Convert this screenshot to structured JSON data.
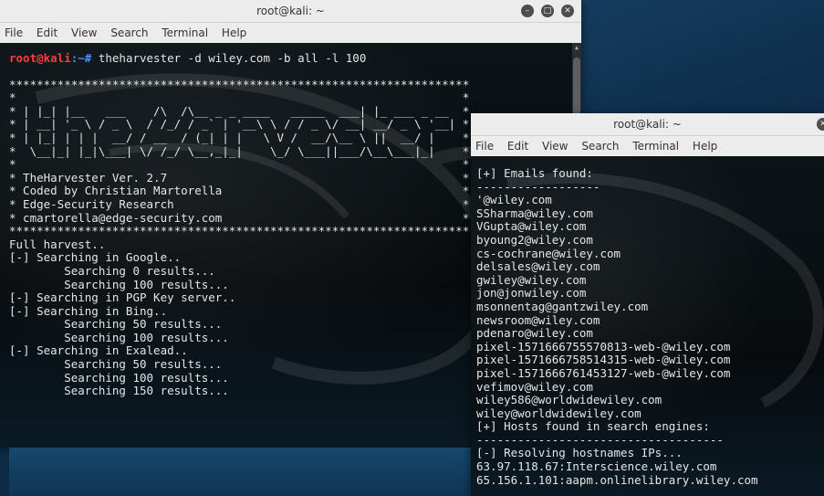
{
  "window1": {
    "title": "root@kali: ~",
    "menu": [
      "File",
      "Edit",
      "View",
      "Search",
      "Terminal",
      "Help"
    ],
    "prompt_user": "root@kali",
    "prompt_path": ":~# ",
    "command": "theharvester -d wiley.com -b all -l 100",
    "banner": "*******************************************************************\n*                                                                 *\n* | |_| |__   ___    /\\  /\\__ _ _ ____   _____  ___| |_ ___ _ __  *\n* | __| '_ \\ / _ \\  / /_/ / _` | '__\\ \\ / / _ \\/ __| __/ _ \\ '__| *\n* | |_| | | |  __/ / __  / (_| | |   \\ V /  __/\\__ \\ ||  __/ |    *\n*  \\__|_| |_|\\___| \\/ /_/ \\__,_|_|    \\_/ \\___||___/\\__\\___|_|    *\n*                                                                 *",
    "info_lines": [
      "* TheHarvester Ver. 2.7                                           *",
      "* Coded by Christian Martorella                                   *",
      "* Edge-Security Research                                          *",
      "* cmartorella@edge-security.com                                   *",
      "*******************************************************************"
    ],
    "output_lines": [
      "",
      "",
      "Full harvest..",
      "[-] Searching in Google..",
      "        Searching 0 results...",
      "        Searching 100 results...",
      "[-] Searching in PGP Key server..",
      "[-] Searching in Bing..",
      "        Searching 50 results...",
      "        Searching 100 results...",
      "[-] Searching in Exalead..",
      "        Searching 50 results...",
      "        Searching 100 results...",
      "        Searching 150 results..."
    ]
  },
  "window2": {
    "title": "root@kali: ~",
    "menu": [
      "File",
      "Edit",
      "View",
      "Search",
      "Terminal",
      "Help"
    ],
    "lines": [
      "[+] Emails found:",
      "------------------",
      "'@wiley.com",
      "SSharma@wiley.com",
      "VGupta@wiley.com",
      "byoung2@wiley.com",
      "cs-cochrane@wiley.com",
      "delsales@wiley.com",
      "gwiley@wiley.com",
      "jon@jonwiley.com",
      "msonnentag@gantzwiley.com",
      "newsroom@wiley.com",
      "pdenaro@wiley.com",
      "pixel-1571666755570813-web-@wiley.com",
      "pixel-1571666758514315-web-@wiley.com",
      "pixel-1571666761453127-web-@wiley.com",
      "vefimov@wiley.com",
      "wiley586@worldwidewiley.com",
      "wiley@worldwidewiley.com",
      "",
      "[+] Hosts found in search engines:",
      "------------------------------------",
      "[-] Resolving hostnames IPs...",
      "63.97.118.67:Interscience.wiley.com",
      "65.156.1.101:aapm.onlinelibrary.wiley.com"
    ]
  },
  "icons": {
    "minimize": "minimize-icon",
    "maximize": "maximize-icon",
    "close": "close-icon"
  }
}
